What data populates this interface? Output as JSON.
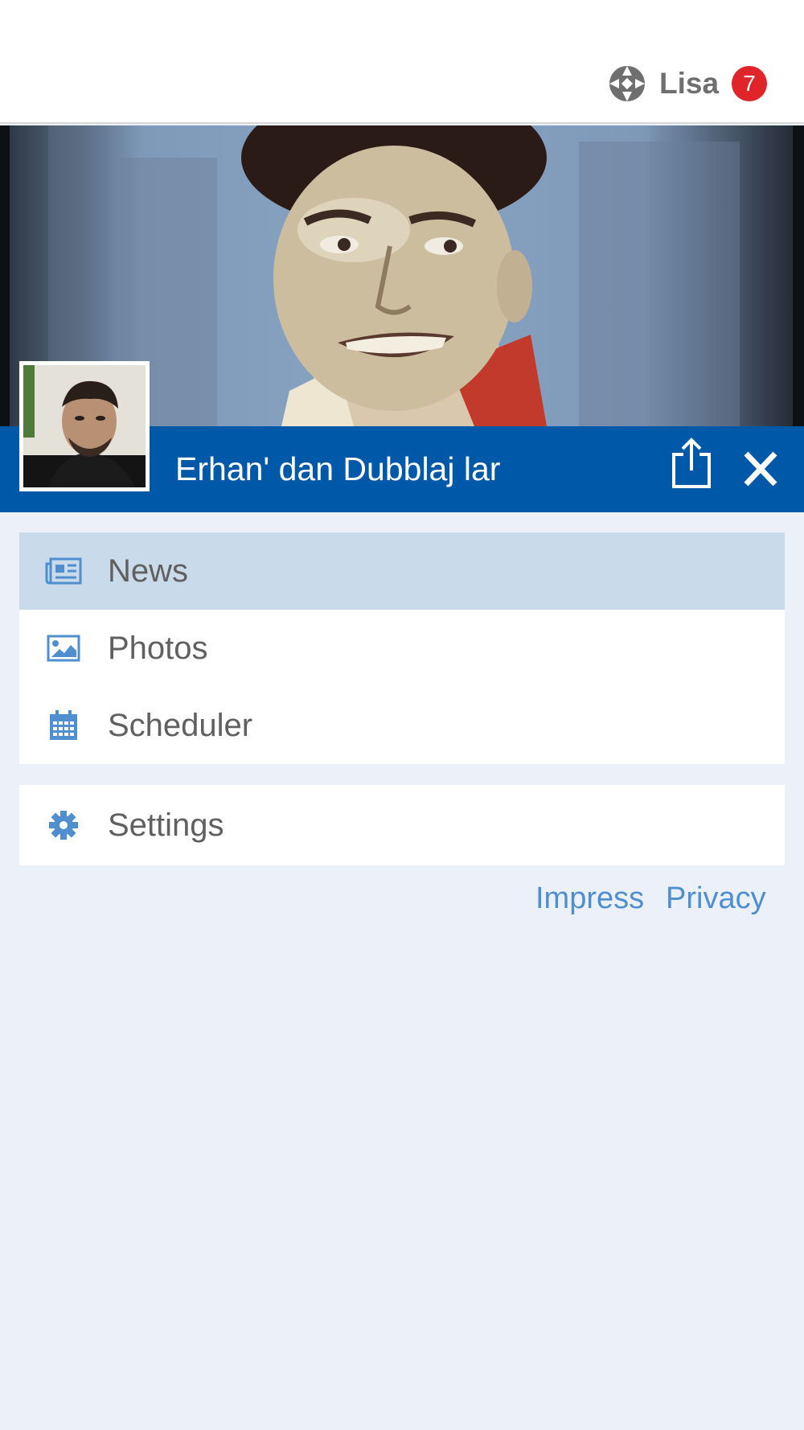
{
  "header": {
    "app_name": "Lisa",
    "notification_count": "7",
    "logo_icon": "app-logo-icon"
  },
  "channel": {
    "title": "Erhan' dan Dubblaj lar",
    "share_icon": "share-icon",
    "close_icon": "close-icon"
  },
  "menu": {
    "items": [
      {
        "label": "News",
        "icon": "newspaper-icon",
        "active": true
      },
      {
        "label": "Photos",
        "icon": "image-icon",
        "active": false
      },
      {
        "label": "Scheduler",
        "icon": "calendar-icon",
        "active": false
      }
    ],
    "settings": {
      "label": "Settings",
      "icon": "gear-icon"
    }
  },
  "footer": {
    "impress": "Impress",
    "privacy": "Privacy"
  },
  "colors": {
    "brand_blue": "#0058a8",
    "active_item": "#c9dbeb",
    "badge_red": "#e0252a",
    "link_blue": "#4f8fcf",
    "background": "#ecf1f9"
  }
}
